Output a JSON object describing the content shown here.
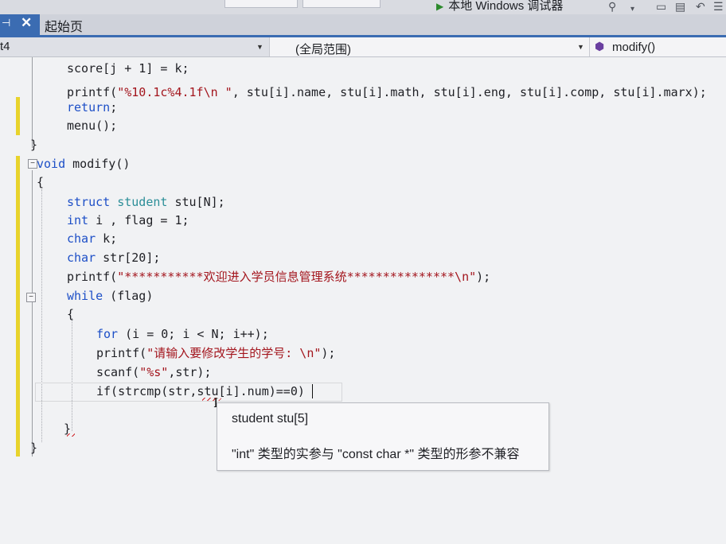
{
  "toolbar": {
    "debugger_label": "本地 Windows 调试器"
  },
  "tab": {
    "title": "起始页"
  },
  "navbar": {
    "project": "t4",
    "scope": "(全局范围)",
    "member": "modify()"
  },
  "code_lines": [
    [
      {
        "t": "score[j + 1] = k;",
        "c": "p"
      }
    ],
    [
      {
        "t": "printf(",
        "c": "p"
      },
      {
        "t": "\"%10.1c%4.1f\\n \"",
        "c": "s"
      },
      {
        "t": ", stu[i].name, stu[i].math, stu[i].eng, stu[i].comp, stu[i].marx);",
        "c": "p"
      }
    ],
    [
      {
        "t": "return",
        "c": "k"
      },
      {
        "t": ";",
        "c": "p"
      }
    ],
    [
      {
        "t": "menu();",
        "c": "p"
      }
    ],
    [
      {
        "t": "}",
        "c": "p"
      }
    ],
    [
      {
        "t": "void",
        "c": "k"
      },
      {
        "t": " modify()",
        "c": "p"
      }
    ],
    [
      {
        "t": "{",
        "c": "p"
      }
    ],
    [
      {
        "t": "struct",
        "c": "k"
      },
      {
        "t": " ",
        "c": "p"
      },
      {
        "t": "student",
        "c": "t"
      },
      {
        "t": " stu[N];",
        "c": "p"
      }
    ],
    [
      {
        "t": "int",
        "c": "k"
      },
      {
        "t": " i , flag = 1;",
        "c": "p"
      }
    ],
    [
      {
        "t": "char",
        "c": "k"
      },
      {
        "t": " k;",
        "c": "p"
      }
    ],
    [
      {
        "t": "char",
        "c": "k"
      },
      {
        "t": " str[20];",
        "c": "p"
      }
    ],
    [
      {
        "t": "printf(",
        "c": "p"
      },
      {
        "t": "\"***********欢迎进入学员信息管理系统***************\\n\"",
        "c": "s"
      },
      {
        "t": ");",
        "c": "p"
      }
    ],
    [
      {
        "t": "while",
        "c": "k"
      },
      {
        "t": " (flag)",
        "c": "p"
      }
    ],
    [
      {
        "t": "{",
        "c": "p"
      }
    ],
    [
      {
        "t": "for",
        "c": "k"
      },
      {
        "t": " (i = 0; i < N; i++);",
        "c": "p"
      }
    ],
    [
      {
        "t": "printf(",
        "c": "p"
      },
      {
        "t": "\"请输入要修改学生的学号: \\n\"",
        "c": "s"
      },
      {
        "t": ");",
        "c": "p"
      }
    ],
    [
      {
        "t": "scanf(",
        "c": "p"
      },
      {
        "t": "\"%s\"",
        "c": "s"
      },
      {
        "t": ",str);",
        "c": "p"
      }
    ],
    [
      {
        "t": "if(strcmp(str,stu[i].num)==0)",
        "c": "p"
      }
    ],
    [
      {
        "t": "",
        "c": "p"
      }
    ],
    [
      {
        "t": "}",
        "c": "p"
      }
    ],
    [
      {
        "t": "}",
        "c": "p"
      }
    ]
  ],
  "tooltip": {
    "signature": "student stu[5]",
    "error": "\"int\" 类型的实参与 \"const char *\" 类型的形参不兼容"
  },
  "colors": {
    "keyword": "#1d4fc7",
    "type": "#2b8e98",
    "string": "#a3151d",
    "change_marker": "#e8d32c",
    "tab_accent": "#3b6cb2"
  }
}
